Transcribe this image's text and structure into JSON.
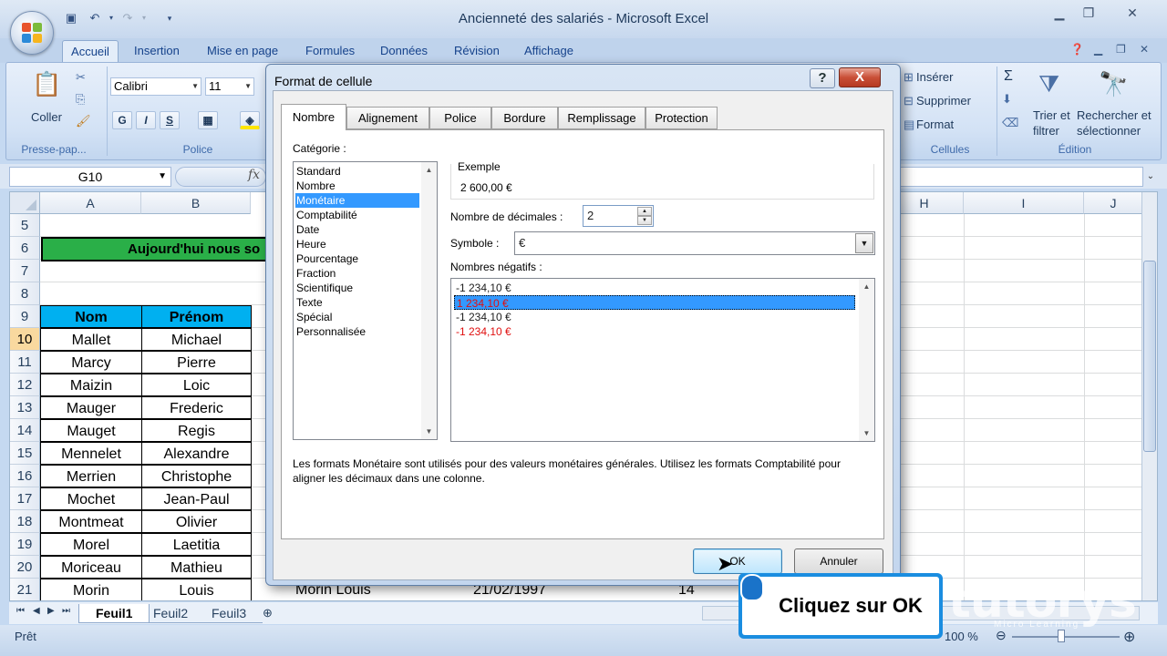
{
  "window": {
    "title": "Ancienneté des salariés - Microsoft Excel"
  },
  "ribbon": {
    "tabs": [
      "Accueil",
      "Insertion",
      "Mise en page",
      "Formules",
      "Données",
      "Révision",
      "Affichage"
    ],
    "groups": {
      "clipboard": "Presse-pap...",
      "font": "Police",
      "cells": "Cellules",
      "editing": "Édition"
    },
    "paste_label": "Coller",
    "font_name": "Calibri",
    "font_size": "11",
    "bold": "G",
    "italic": "I",
    "underline": "S",
    "insert": "Insérer",
    "delete": "Supprimer",
    "format": "Format",
    "sort_line1": "Trier et",
    "sort_line2": "filtrer",
    "find_line1": "Rechercher et",
    "find_line2": "sélectionner"
  },
  "formula_bar": {
    "namebox": "G10",
    "fx": "fx",
    "content": ""
  },
  "sheet": {
    "columns": [
      "A",
      "B",
      "H",
      "I",
      "J"
    ],
    "rows": [
      "5",
      "6",
      "7",
      "8",
      "9",
      "10",
      "11",
      "12",
      "13",
      "14",
      "15",
      "16",
      "17",
      "18",
      "19",
      "20",
      "21"
    ],
    "banner_text": "Aujourd'hui nous so",
    "header": {
      "nom": "Nom",
      "prenom": "Prénom"
    },
    "data": [
      [
        "Mallet",
        "Michael"
      ],
      [
        "Marcy",
        "Pierre"
      ],
      [
        "Maizin",
        "Loic"
      ],
      [
        "Mauger",
        "Frederic"
      ],
      [
        "Mauget",
        "Regis"
      ],
      [
        "Mennelet",
        "Alexandre"
      ],
      [
        "Merrien",
        "Christophe"
      ],
      [
        "Mochet",
        "Jean-Paul"
      ],
      [
        "Montmeat",
        "Olivier"
      ],
      [
        "Morel",
        "Laetitia"
      ],
      [
        "Moriceau",
        "Mathieu"
      ],
      [
        "Morin",
        "Louis"
      ]
    ],
    "peek_row21": [
      "Morin Louis",
      "21/02/1997",
      "14"
    ],
    "tabs": [
      "Feuil1",
      "Feuil2",
      "Feuil3"
    ]
  },
  "status": {
    "ready": "Prêt",
    "zoom": "100 %"
  },
  "dialog": {
    "title": "Format de cellule",
    "help": "?",
    "close": "X",
    "tabs": [
      "Nombre",
      "Alignement",
      "Police",
      "Bordure",
      "Remplissage",
      "Protection"
    ],
    "category_label": "Catégorie :",
    "categories": [
      "Standard",
      "Nombre",
      "Monétaire",
      "Comptabilité",
      "Date",
      "Heure",
      "Pourcentage",
      "Fraction",
      "Scientifique",
      "Texte",
      "Spécial",
      "Personnalisée"
    ],
    "selected_category": "Monétaire",
    "example_label": "Exemple",
    "example_value": "2 600,00 €",
    "decimals_label": "Nombre de décimales :",
    "decimals_value": "2",
    "symbol_label": "Symbole :",
    "symbol_value": "€",
    "negatives_label": "Nombres négatifs :",
    "negatives": [
      "-1 234,10 €",
      "1 234,10 €",
      "-1 234,10 €",
      "-1 234,10 €"
    ],
    "description": "Les formats Monétaire sont utilisés pour des valeurs monétaires générales. Utilisez les formats Comptabilité pour aligner les décimaux dans une colonne.",
    "ok": "OK",
    "cancel": "Annuler"
  },
  "callout": {
    "text": "Cliquez sur OK"
  },
  "watermark": {
    "brand": "tutorys",
    "sub": "Micro Learning"
  },
  "colors": {
    "banner_green": "#2aaf48",
    "header_blue": "#00b0f0",
    "selection_blue": "#3399ff",
    "negative_red": "#e01010",
    "callout_blue": "#1a8de0"
  }
}
